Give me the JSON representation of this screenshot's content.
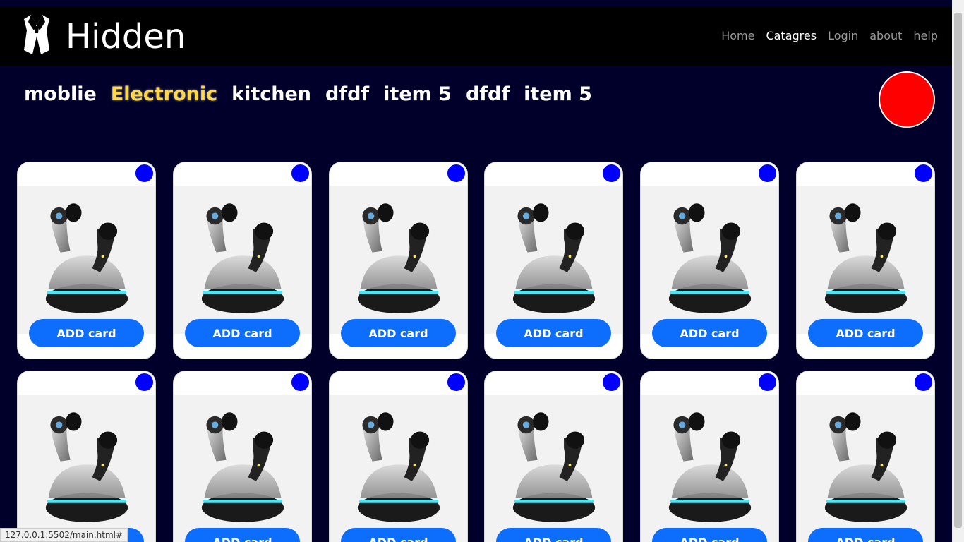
{
  "header": {
    "brand": "Hidden",
    "nav": [
      "Home",
      "Catagres",
      "Login",
      "about",
      "help"
    ],
    "active_nav": "Catagres"
  },
  "categories": {
    "items": [
      "moblie",
      "Electronic",
      "kitchen",
      "dfdf",
      "item 5",
      "dfdf",
      "item 5"
    ],
    "active": "Electronic"
  },
  "products": {
    "button_label": "ADD card",
    "count": 12,
    "image_icon": "wireless-earbuds-case"
  },
  "status_bar": {
    "url": "127.0.0.1:5502/main.html#"
  },
  "colors": {
    "page_bg": "#00002a",
    "header_bg": "#000000",
    "active_category": "#ffd84a",
    "avatar": "#ff0000",
    "badge": "#0000ff",
    "button": "#0d6efd"
  }
}
